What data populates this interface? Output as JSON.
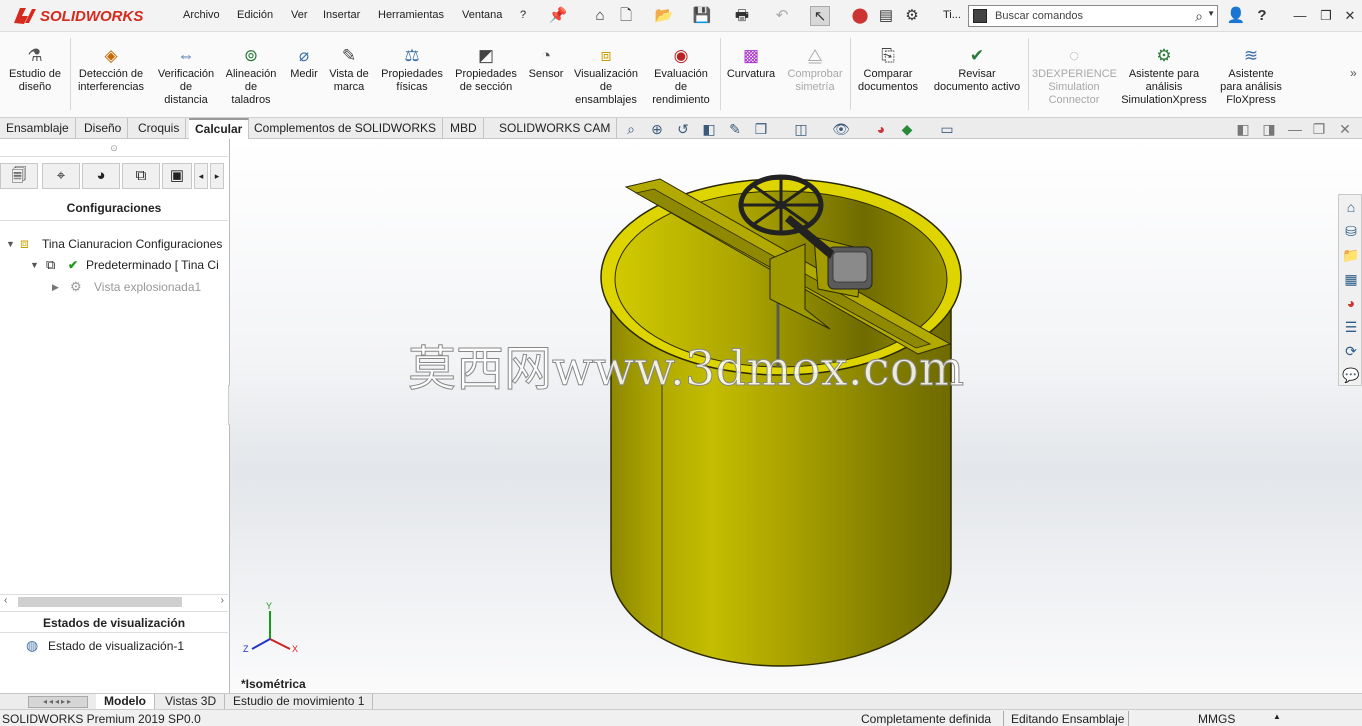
{
  "titlebar": {
    "brand": "SOLIDWORKS",
    "menus": [
      "Archivo",
      "Edición",
      "Ver",
      "Insertar",
      "Herramientas",
      "Ventana",
      "?"
    ],
    "tile_label": "Ti...",
    "search_placeholder": "Buscar comandos"
  },
  "ribbon": {
    "buttons": [
      {
        "label": "Estudio de\ndiseño",
        "icon": "design-study-icon"
      },
      {
        "label": "Detección de\ninterferencias",
        "icon": "interference-icon"
      },
      {
        "label": "Verificación\nde\ndistancia",
        "icon": "clearance-icon"
      },
      {
        "label": "Alineación\nde\ntaladros",
        "icon": "hole-align-icon"
      },
      {
        "label": "Medir",
        "icon": "measure-icon"
      },
      {
        "label": "Vista de\nmarca",
        "icon": "markup-icon"
      },
      {
        "label": "Propiedades\nfísicas",
        "icon": "mass-props-icon"
      },
      {
        "label": "Propiedades\nde sección",
        "icon": "section-props-icon"
      },
      {
        "label": "Sensor",
        "icon": "sensor-icon"
      },
      {
        "label": "Visualización\nde\nensamblajes",
        "icon": "assembly-vis-icon"
      },
      {
        "label": "Evaluación\nde\nrendimiento",
        "icon": "performance-icon"
      },
      {
        "label": "Curvatura",
        "icon": "curvature-icon"
      },
      {
        "label": "Comprobar\nsimetría",
        "icon": "symmetry-icon"
      },
      {
        "label": "Comparar\ndocumentos",
        "icon": "compare-icon"
      },
      {
        "label": "Revisar\ndocumento activo",
        "icon": "check-doc-icon"
      },
      {
        "label": "3DEXPERIENCE\nSimulation\nConnector",
        "icon": "3dx-icon"
      },
      {
        "label": "Asistente para\nanálisis\nSimulationXpress",
        "icon": "simxpress-icon"
      },
      {
        "label": "Asistente\npara análisis\nFloXpress",
        "icon": "floxpress-icon"
      }
    ]
  },
  "tabs": [
    "Ensamblaje",
    "Diseño",
    "Croquis",
    "Calcular",
    "Complementos de SOLIDWORKS",
    "MBD",
    "SOLIDWORKS CAM"
  ],
  "panel": {
    "title": "Configuraciones",
    "tree": [
      {
        "label": "Tina Cianuracion Configuraciones"
      },
      {
        "label": "Predeterminado [ Tina Ci"
      },
      {
        "label": "Vista explosionada1"
      }
    ],
    "display_title": "Estados de visualización",
    "display_item": "Estado de visualización-1"
  },
  "viewport": {
    "watermark": "莫西网www.3dmox.com",
    "view_label": "*Isométrica",
    "triad": {
      "y": "Y",
      "x": "X",
      "z": "Z"
    }
  },
  "bottom_tabs": [
    "Modelo",
    "Vistas 3D",
    "Estudio de movimiento 1"
  ],
  "status": {
    "product": "SOLIDWORKS Premium 2019 SP0.0",
    "definition": "Completamente definida",
    "mode": "Editando Ensamblaje",
    "units": "MMGS"
  },
  "colors": {
    "model_yellow": "#a9a300",
    "model_dark": "#6f6b00",
    "brand_red": "#d52b1e",
    "viewport_bg": "#eef0f3"
  }
}
